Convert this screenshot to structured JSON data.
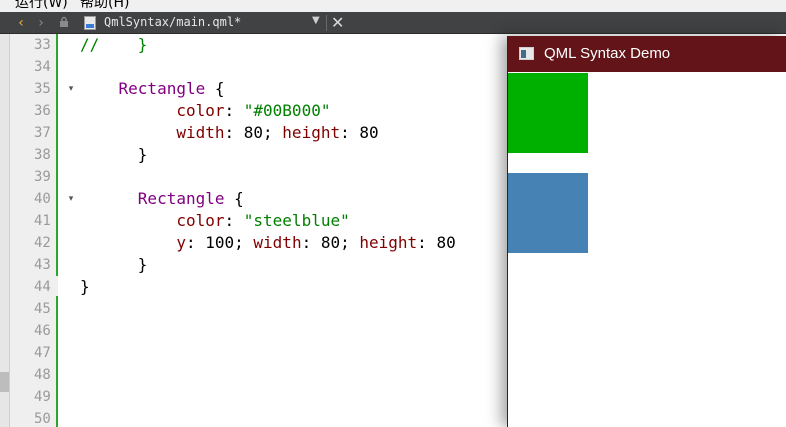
{
  "menu": {
    "items": [
      "运行(W)",
      "帮助(H)"
    ]
  },
  "toolbar": {
    "back_icon": "chevron-left-icon",
    "forward_icon": "chevron-right-icon",
    "lock_icon": "lock-icon",
    "file_icon": "qml-file-icon",
    "title": "QmlSyntax/main.qml*",
    "dropdown_icon": "triangle-down-icon",
    "close_icon": "close-icon"
  },
  "editor": {
    "line_numbers": [
      "33",
      "34",
      "35",
      "36",
      "37",
      "38",
      "39",
      "40",
      "41",
      "42",
      "43",
      "44",
      "45",
      "46",
      "47",
      "48",
      "49",
      "50"
    ],
    "fold_markers": {
      "35": "▾",
      "40": "▾"
    },
    "lines": [
      {
        "parts": [
          {
            "t": "//    }",
            "c": "cmt"
          }
        ]
      },
      {
        "parts": []
      },
      {
        "parts": [
          {
            "t": "    "
          },
          {
            "t": "Rectangle",
            "c": "kw-type"
          },
          {
            "t": " {"
          }
        ]
      },
      {
        "parts": [
          {
            "t": "          "
          },
          {
            "t": "color",
            "c": "kw-prop"
          },
          {
            "t": ": "
          },
          {
            "t": "\"#00B000\"",
            "c": "str"
          }
        ]
      },
      {
        "parts": [
          {
            "t": "          "
          },
          {
            "t": "width",
            "c": "kw-prop"
          },
          {
            "t": ": 80; "
          },
          {
            "t": "height",
            "c": "kw-prop"
          },
          {
            "t": ": 80"
          }
        ]
      },
      {
        "parts": [
          {
            "t": "      }"
          }
        ]
      },
      {
        "parts": []
      },
      {
        "parts": [
          {
            "t": "      "
          },
          {
            "t": "Rectangle",
            "c": "kw-type"
          },
          {
            "t": " {"
          }
        ]
      },
      {
        "parts": [
          {
            "t": "          "
          },
          {
            "t": "color",
            "c": "kw-prop"
          },
          {
            "t": ": "
          },
          {
            "t": "\"steelblue\"",
            "c": "str"
          }
        ]
      },
      {
        "parts": [
          {
            "t": "          "
          },
          {
            "t": "y",
            "c": "kw-prop"
          },
          {
            "t": ": 100; "
          },
          {
            "t": "width",
            "c": "kw-prop"
          },
          {
            "t": ": 80; "
          },
          {
            "t": "height",
            "c": "kw-prop"
          },
          {
            "t": ": 80"
          }
        ]
      },
      {
        "parts": [
          {
            "t": "      }"
          }
        ]
      },
      {
        "parts": [
          {
            "t": "}"
          }
        ]
      },
      {
        "parts": []
      },
      {
        "parts": []
      },
      {
        "parts": []
      },
      {
        "parts": []
      },
      {
        "parts": []
      },
      {
        "parts": []
      }
    ]
  },
  "demo_window": {
    "title": "QML Syntax Demo",
    "app_icon": "app-window-icon",
    "rect1_color": "#00B000",
    "rect2_color": "steelblue"
  },
  "colors": {
    "titlebar": "#621419",
    "toolbar": "#404244",
    "change_marker": "#2fa52f"
  }
}
